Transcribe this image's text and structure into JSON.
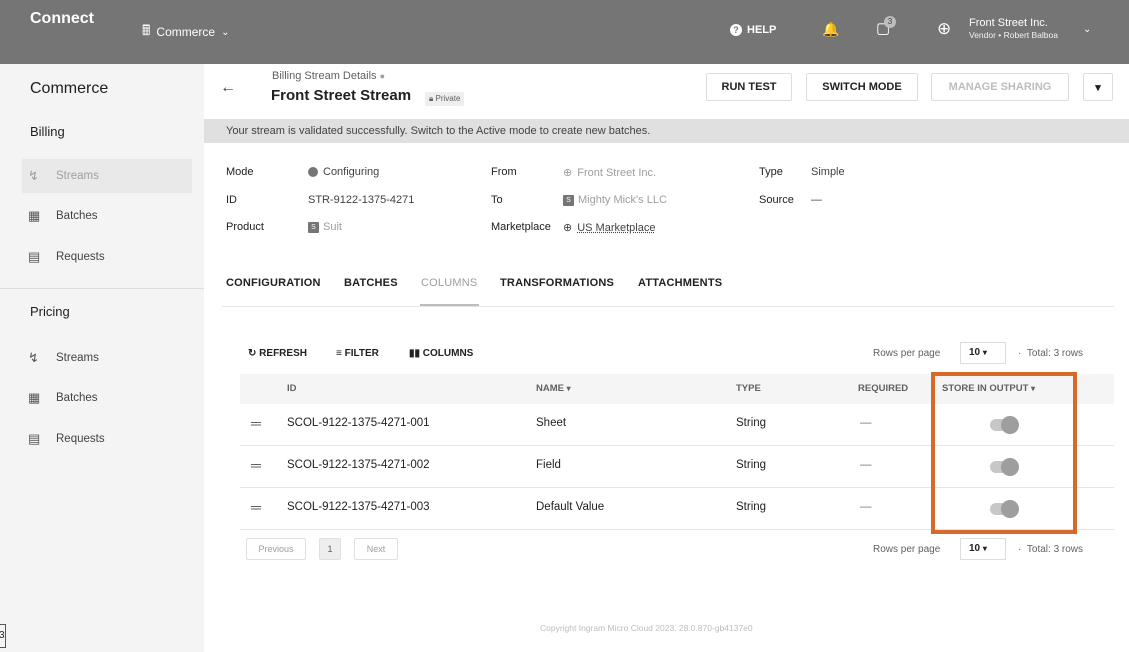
{
  "topbar": {
    "brand": "Connect",
    "module": "Commerce",
    "help": "HELP",
    "requests_badge": "3",
    "account_name": "Front Street Inc.",
    "account_sub": "Vendor • Robert Balboa"
  },
  "sidebar": {
    "title": "Commerce",
    "billing": {
      "title": "Billing",
      "items": [
        {
          "label": "Streams"
        },
        {
          "label": "Batches"
        },
        {
          "label": "Requests"
        }
      ]
    },
    "pricing": {
      "title": "Pricing",
      "items": [
        {
          "label": "Streams"
        },
        {
          "label": "Batches"
        },
        {
          "label": "Requests"
        }
      ]
    }
  },
  "header": {
    "breadcrumb": "Billing Stream Details",
    "title": "Front Street Stream",
    "privacy": "Private",
    "run_test": "RUN TEST",
    "switch_mode": "SWITCH MODE",
    "manage_sharing": "MANAGE SHARING"
  },
  "notice": "Your stream is validated successfully. Switch to the Active mode to create new batches.",
  "details": {
    "mode_label": "Mode",
    "mode_value": "Configuring",
    "id_label": "ID",
    "id_value": "STR-9122-1375-4271",
    "product_label": "Product",
    "product_value": "Suit",
    "from_label": "From",
    "from_value": "Front Street Inc.",
    "to_label": "To",
    "to_value": "Mighty Mick's LLC",
    "marketplace_label": "Marketplace",
    "marketplace_value": "US Marketplace",
    "type_label": "Type",
    "type_value": "Simple",
    "source_label": "Source",
    "source_value": "—"
  },
  "tabs": [
    "CONFIGURATION",
    "BATCHES",
    "COLUMNS",
    "TRANSFORMATIONS",
    "ATTACHMENTS"
  ],
  "toolbar": {
    "refresh": "REFRESH",
    "filter": "FILTER",
    "columns": "COLUMNS"
  },
  "pagination": {
    "rows_per_page_label": "Rows per page",
    "rows_per_page": "10",
    "total": "Total: 3 rows",
    "previous": "Previous",
    "page": "1",
    "next": "Next"
  },
  "table": {
    "headers": [
      "ID",
      "NAME",
      "TYPE",
      "REQUIRED",
      "STORE IN OUTPUT"
    ],
    "rows": [
      {
        "id": "SCOL-9122-1375-4271-001",
        "name": "Sheet",
        "type": "String",
        "required": "—",
        "store": true
      },
      {
        "id": "SCOL-9122-1375-4271-002",
        "name": "Field",
        "type": "String",
        "required": "—",
        "store": true
      },
      {
        "id": "SCOL-9122-1375-4271-003",
        "name": "Default Value",
        "type": "String",
        "required": "—",
        "store": true
      }
    ]
  },
  "footer": "Copyright Ingram Micro Cloud 2023. 28.0.870-gb4137e0",
  "corner_glyph": "3"
}
